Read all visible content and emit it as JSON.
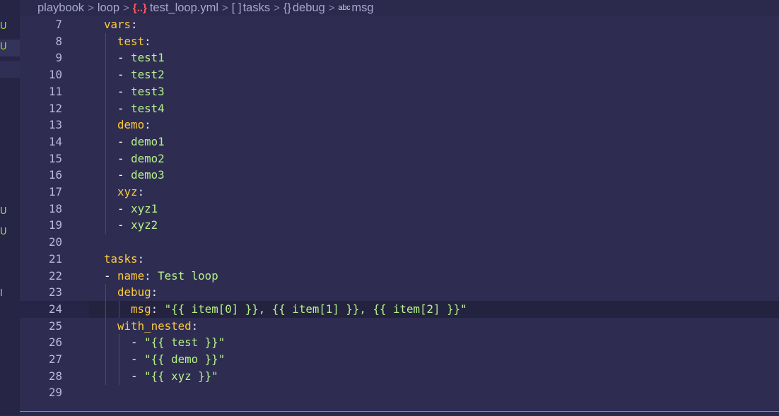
{
  "breadcrumb": {
    "items": [
      "playbook",
      "loop",
      "test_loop.yml",
      "tasks",
      "debug",
      "msg"
    ],
    "icons": {
      "file": "{..}",
      "array": "[ ]",
      "object": "{}",
      "string": "abc"
    },
    "separator": ">"
  },
  "explorer_strip": {
    "badges": [
      "U",
      "U",
      "U",
      "U",
      "I"
    ]
  },
  "editor": {
    "active_line": "24",
    "lines": [
      {
        "num": "7",
        "indent": "  ",
        "key": "vars",
        "colon": ":",
        "value": ""
      },
      {
        "num": "8",
        "indent": "    ",
        "key": "test",
        "colon": ":",
        "value": ""
      },
      {
        "num": "9",
        "indent": "    ",
        "dash": "- ",
        "value": "test1"
      },
      {
        "num": "10",
        "indent": "    ",
        "dash": "- ",
        "value": "test2"
      },
      {
        "num": "11",
        "indent": "    ",
        "dash": "- ",
        "value": "test3"
      },
      {
        "num": "12",
        "indent": "    ",
        "dash": "- ",
        "value": "test4"
      },
      {
        "num": "13",
        "indent": "    ",
        "key": "demo",
        "colon": ":",
        "value": ""
      },
      {
        "num": "14",
        "indent": "    ",
        "dash": "- ",
        "value": "demo1"
      },
      {
        "num": "15",
        "indent": "    ",
        "dash": "- ",
        "value": "demo2"
      },
      {
        "num": "16",
        "indent": "    ",
        "dash": "- ",
        "value": "demo3"
      },
      {
        "num": "17",
        "indent": "    ",
        "key": "xyz",
        "colon": ":",
        "value": ""
      },
      {
        "num": "18",
        "indent": "    ",
        "dash": "- ",
        "value": "xyz1"
      },
      {
        "num": "19",
        "indent": "    ",
        "dash": "- ",
        "value": "xyz2"
      },
      {
        "num": "20",
        "indent": "",
        "value": ""
      },
      {
        "num": "21",
        "indent": "  ",
        "key": "tasks",
        "colon": ":",
        "value": ""
      },
      {
        "num": "22",
        "indent": "  ",
        "dash": "- ",
        "key": "name",
        "colon": ": ",
        "value": "Test loop"
      },
      {
        "num": "23",
        "indent": "    ",
        "key": "debug",
        "colon": ":",
        "value": ""
      },
      {
        "num": "24",
        "indent": "      ",
        "key": "msg",
        "colon": ": ",
        "value": "\"{{ item[0] }}, {{ item[1] }}, {{ item[2] }}\""
      },
      {
        "num": "25",
        "indent": "    ",
        "key": "with_nested",
        "colon": ":",
        "value": ""
      },
      {
        "num": "26",
        "indent": "      ",
        "dash": "- ",
        "value": "\"{{ test }}\""
      },
      {
        "num": "27",
        "indent": "      ",
        "dash": "- ",
        "value": "\"{{ demo }}\""
      },
      {
        "num": "28",
        "indent": "      ",
        "dash": "- ",
        "value": "\"{{ xyz }}\""
      },
      {
        "num": "29",
        "indent": "",
        "value": ""
      }
    ]
  },
  "colors": {
    "background": "#2e2d51",
    "key": "#ffca3a",
    "string": "#b6f08a",
    "line_number": "#bab9d9",
    "git_untracked": "#a6e22e"
  }
}
